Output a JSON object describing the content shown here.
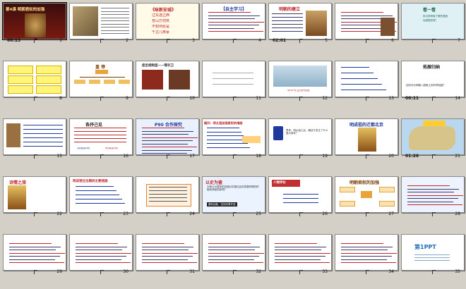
{
  "slides": [
    {
      "num": "1",
      "time": "00:13",
      "title": "第4课 明朝君权的加强",
      "kind": "cover"
    },
    {
      "num": "2",
      "time": "",
      "title": "",
      "kind": "painting"
    },
    {
      "num": "3",
      "time": "",
      "title": "《咏新安城》",
      "kind": "poem",
      "lines": [
        "辽东连辽西",
        "苍山万仞高",
        "不知何处是",
        "千古几英豪"
      ]
    },
    {
      "num": "4",
      "time": "",
      "title": "【自主学习】",
      "kind": "questions"
    },
    {
      "num": "5",
      "time": "02:01",
      "title": "明朝的建立",
      "kind": "portrait"
    },
    {
      "num": "6",
      "time": "",
      "title": "",
      "kind": "text-portrait"
    },
    {
      "num": "7",
      "time": "",
      "title": "看一看",
      "kind": "think",
      "lines": [
        "朱元璋采取了哪些措施",
        "加强君权呢？"
      ]
    },
    {
      "num": "8",
      "time": "",
      "title": "",
      "kind": "chart-yellow"
    },
    {
      "num": "9",
      "time": "",
      "title": "皇 帝",
      "kind": "tree"
    },
    {
      "num": "10",
      "time": "",
      "title": "废丞相制度——锦衣卫",
      "kind": "images"
    },
    {
      "num": "11",
      "time": "",
      "title": "",
      "kind": "blank"
    },
    {
      "num": "12",
      "time": "",
      "title": "",
      "kind": "photo",
      "caption": "科举考生答卷图"
    },
    {
      "num": "13",
      "time": "",
      "title": "",
      "kind": "diagram-blue"
    },
    {
      "num": "14",
      "time": "00:11",
      "title": "拓展归纳",
      "kind": "summary",
      "lines": [
        "如何评价明朝八股取士的科举制度？"
      ]
    },
    {
      "num": "15",
      "time": "",
      "title": "",
      "kind": "person-text"
    },
    {
      "num": "16",
      "time": "",
      "title": "各抒己见",
      "kind": "discussion",
      "lines": [
        "消极影响",
        "积极影响"
      ]
    },
    {
      "num": "17",
      "time": "",
      "title": "P90 合作探究",
      "kind": "dense"
    },
    {
      "num": "18",
      "time": "",
      "title": "疑问：明太祖加强君权的措施",
      "kind": "measures"
    },
    {
      "num": "19",
      "time": "",
      "title": "",
      "kind": "question-two",
      "lines": [
        "思考：明太祖之后，朝廷又发生了什么重大事件？"
      ]
    },
    {
      "num": "20",
      "time": "",
      "title": "明成祖的迁都北京",
      "kind": "emperor"
    },
    {
      "num": "21",
      "time": "01:26",
      "title": "",
      "kind": "map"
    },
    {
      "num": "22",
      "time": "",
      "title": "诗情之旅",
      "kind": "emperor2"
    },
    {
      "num": "23",
      "time": "",
      "title": "明成祖在位期间主要措施",
      "kind": "list"
    },
    {
      "num": "24",
      "time": "",
      "title": "",
      "kind": "orange-box"
    },
    {
      "num": "25",
      "time": "",
      "title": "以史为鉴",
      "kind": "lesson",
      "lines": [
        "大家认为君权的加强对中国社会的发展有哪些积极和消极的影响？",
        "要有创新，坚持改革开放"
      ]
    },
    {
      "num": "26",
      "time": "",
      "title": "人物评价",
      "kind": "evaluate"
    },
    {
      "num": "27",
      "time": "",
      "title": "明朝君权的加强",
      "kind": "mindmap"
    },
    {
      "num": "28",
      "time": "",
      "title": "",
      "kind": "practice"
    },
    {
      "num": "29",
      "time": "",
      "title": "",
      "kind": "exercise"
    },
    {
      "num": "30",
      "time": "",
      "title": "",
      "kind": "exercise2"
    },
    {
      "num": "31",
      "time": "",
      "title": "",
      "kind": "exercise3"
    },
    {
      "num": "32",
      "time": "",
      "title": "",
      "kind": "exercise4"
    },
    {
      "num": "33",
      "time": "",
      "title": "",
      "kind": "exercise5"
    },
    {
      "num": "34",
      "time": "",
      "title": "",
      "kind": "exercise6"
    },
    {
      "num": "35",
      "time": "",
      "title": "第1PPT",
      "kind": "brand"
    }
  ],
  "colors": {
    "bg": "#d4d0c8",
    "titleBlue": "#1f3a9c",
    "titleRed": "#c0262a",
    "accentYellow": "#fff57a"
  }
}
